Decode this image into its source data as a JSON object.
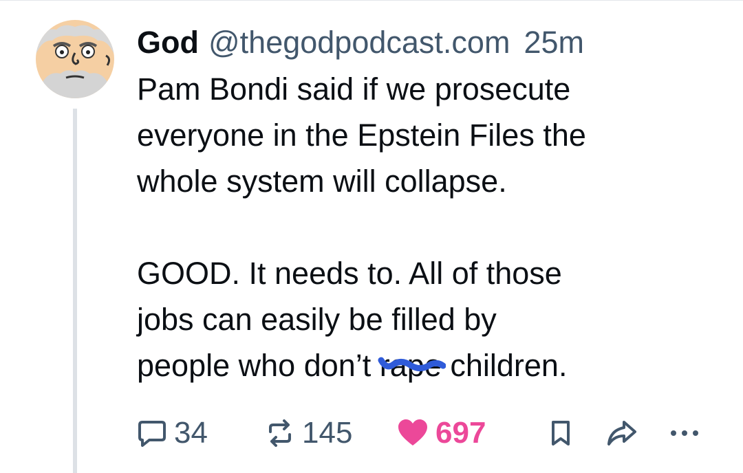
{
  "post": {
    "display_name": "God",
    "handle": "@thegodpodcast.com",
    "time": "25m",
    "text_paragraphs": [
      [
        "Pam Bondi said if we prosecute",
        "everyone in the Epstein Files the",
        "whole system will collapse."
      ],
      [
        "GOOD. It needs to. All of those",
        "jobs can easily be filled by"
      ]
    ],
    "last_line": {
      "before": "people who don’t ",
      "scribbled": "rape",
      "after": " children."
    }
  },
  "actions": {
    "reply_count": "34",
    "repost_count": "145",
    "like_count": "697"
  },
  "colors": {
    "text": "#0b0f14",
    "muted": "#42576c",
    "like": "#ec4899",
    "scribble": "#2f5bd9",
    "thread_line": "#dde1e6"
  },
  "icons": [
    "avatar",
    "reply-icon",
    "repost-icon",
    "heart-icon",
    "bookmark-icon",
    "share-icon",
    "more-icon"
  ]
}
